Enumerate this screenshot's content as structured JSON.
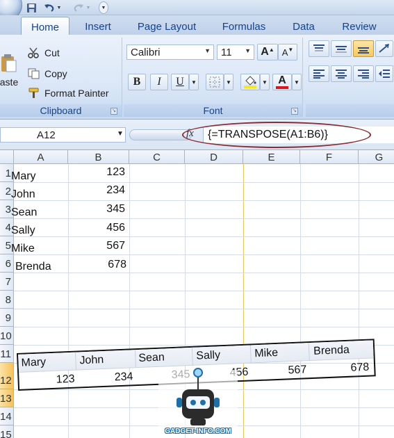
{
  "qat": {
    "icons": [
      "save-icon",
      "undo-icon",
      "redo-icon",
      "customize-icon"
    ]
  },
  "tabs": [
    {
      "label": "Home",
      "active": true
    },
    {
      "label": "Insert"
    },
    {
      "label": "Page Layout"
    },
    {
      "label": "Formulas"
    },
    {
      "label": "Data"
    },
    {
      "label": "Review"
    }
  ],
  "clipboard": {
    "paste_label": "aste",
    "cut_label": "Cut",
    "copy_label": "Copy",
    "format_painter_label": "Format Painter",
    "group_label": "Clipboard"
  },
  "font": {
    "name": "Calibri",
    "size": "11",
    "bold": "B",
    "italic": "I",
    "underline": "U",
    "font_color_glyph": "A",
    "group_label": "Font"
  },
  "formula_bar": {
    "name_box": "A12",
    "fx": "fx",
    "formula": "{=TRANSPOSE(A1:B6)}"
  },
  "columns": [
    "A",
    "B",
    "C",
    "D",
    "E",
    "F",
    "G"
  ],
  "rows": [
    "1",
    "2",
    "3",
    "4",
    "5",
    "6",
    "7",
    "8",
    "9",
    "10",
    "11",
    "12",
    "13",
    "14",
    "15"
  ],
  "data": [
    {
      "name": "Mary",
      "value": "123"
    },
    {
      "name": "John",
      "value": "234"
    },
    {
      "name": "Sean",
      "value": "345"
    },
    {
      "name": "Sally",
      "value": "456"
    },
    {
      "name": "Mike",
      "value": "567"
    },
    {
      "name": "Brenda",
      "value": "678"
    }
  ],
  "transposed": {
    "names": [
      "Mary",
      "John",
      "Sean",
      "Sally",
      "Mike",
      "Brenda"
    ],
    "values": [
      "123",
      "234",
      "345",
      "456",
      "567",
      "678"
    ]
  },
  "watermark": "GADGET-INFO.COM",
  "colors": {
    "accent": "#15428b",
    "ellipse": "#8a2a32",
    "font_color_bar": "#d8161c",
    "highlight_bar": "#f6e623"
  }
}
